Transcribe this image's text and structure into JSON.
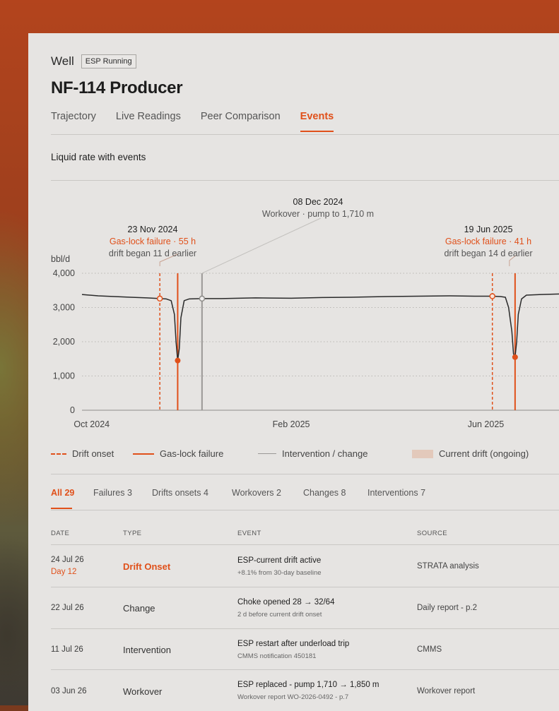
{
  "header": {
    "breadcrumb": "Well",
    "status_badge": "ESP Running",
    "title": "NF-114 Producer"
  },
  "tabs": [
    {
      "label": "Trajectory",
      "active": false
    },
    {
      "label": "Live Readings",
      "active": false
    },
    {
      "label": "Peer Comparison",
      "active": false
    },
    {
      "label": "Events",
      "active": true
    }
  ],
  "chart_section": {
    "title": "Liquid rate with events"
  },
  "chart_data": {
    "type": "line",
    "title": "",
    "ylabel": "bbl/d",
    "xlabel": "",
    "ylim": [
      0,
      4000
    ],
    "yticks": [
      "0",
      "1,000",
      "2,000",
      "3,000",
      "4,000"
    ],
    "xticks": [
      "Oct 2024",
      "Feb 2025",
      "Jun 2025"
    ],
    "grid": true,
    "series": [
      {
        "x": [
          "2024-09-25",
          "2024-10-05",
          "2024-10-15",
          "2024-10-25",
          "2024-11-04",
          "2024-11-12",
          "2024-11-16",
          "2024-11-19",
          "2024-11-21",
          "2024-11-22",
          "2024-11-23",
          "2024-11-24",
          "2024-11-25",
          "2024-11-27",
          "2024-11-30",
          "2024-12-08",
          "2024-12-20",
          "2025-01-10",
          "2025-02-01",
          "2025-02-20",
          "2025-03-10",
          "2025-04-01",
          "2025-04-20",
          "2025-05-10",
          "2025-05-25",
          "2025-06-05",
          "2025-06-10",
          "2025-06-13",
          "2025-06-15",
          "2025-06-17",
          "2025-06-18",
          "2025-06-19",
          "2025-06-20",
          "2025-06-21",
          "2025-06-23",
          "2025-06-26",
          "2025-07-05",
          "2025-07-20"
        ],
        "y": [
          3380,
          3340,
          3320,
          3300,
          3280,
          3260,
          3250,
          3200,
          2800,
          2000,
          1450,
          1800,
          2700,
          3200,
          3250,
          3260,
          3260,
          3280,
          3270,
          3290,
          3300,
          3320,
          3330,
          3340,
          3330,
          3330,
          3320,
          3300,
          3000,
          2300,
          1650,
          1550,
          2000,
          2800,
          3250,
          3360,
          3380,
          3400
        ]
      }
    ],
    "markers": {
      "drift_onset_points": [
        {
          "x": "2024-11-12",
          "y": 3260
        },
        {
          "x": "2025-06-05",
          "y": 3330
        }
      ],
      "failure_points": [
        {
          "x": "2024-11-23",
          "y": 1450
        },
        {
          "x": "2025-06-19",
          "y": 1550
        }
      ],
      "intervention_points": [
        {
          "x": "2024-12-08",
          "y": 3260
        }
      ]
    },
    "legend_position": "bottom"
  },
  "annotations": [
    {
      "date": "23 Nov 2024",
      "line2": "Gas-lock failure · 55 h",
      "line3": "drift began 11 d earlier"
    },
    {
      "date": "08 Dec 2024",
      "line2": "Workover · pump to 1,710 m",
      "line3": ""
    },
    {
      "date": "19 Jun 2025",
      "line2": "Gas-lock failure · 41 h",
      "line3": "drift began 14 d earlier"
    }
  ],
  "legend": {
    "drift_onset": "Drift onset",
    "gas_lock_failure": "Gas-lock failure",
    "intervention": "Intervention / change",
    "current_drift": "Current drift (ongoing)"
  },
  "filters": [
    {
      "label": "All",
      "count": "29",
      "active": true
    },
    {
      "label": "Failures",
      "count": "3",
      "active": false
    },
    {
      "label": "Drifts onsets",
      "count": "4",
      "active": false
    },
    {
      "label": "Workovers",
      "count": "2",
      "active": false
    },
    {
      "label": "Changes",
      "count": "8",
      "active": false
    },
    {
      "label": "Interventions",
      "count": "7",
      "active": false
    }
  ],
  "table": {
    "headers": {
      "date": "DATE",
      "type": "TYPE",
      "event": "EVENT",
      "source": "SOURCE"
    },
    "rows": [
      {
        "date": "24 Jul 26",
        "date_sub": "Day 12",
        "type": "Drift Onset",
        "event": "ESP-current drift active",
        "event_sub": "+8.1% from 30-day baseline",
        "source": "STRATA analysis"
      },
      {
        "date": "22 Jul 26",
        "date_sub": "",
        "type": "Change",
        "event": "Choke opened 28 → 32/64",
        "event_sub": "2 d before current drift onset",
        "source": "Daily report - p.2"
      },
      {
        "date": "11 Jul 26",
        "date_sub": "",
        "type": "Intervention",
        "event": "ESP restart after underload trip",
        "event_sub": "CMMS notification 450181",
        "source": "CMMS"
      },
      {
        "date": "03 Jun 26",
        "date_sub": "",
        "type": "Workover",
        "event": "ESP replaced - pump 1,710 → 1,850 m",
        "event_sub": "Workover report WO-2026-0492 - p.7",
        "source": "Workover report"
      }
    ]
  },
  "colors": {
    "accent": "#e0501a",
    "line": "#2a2a2a",
    "intervention": "#9a9896",
    "current_drift": "#e3c9bb"
  }
}
